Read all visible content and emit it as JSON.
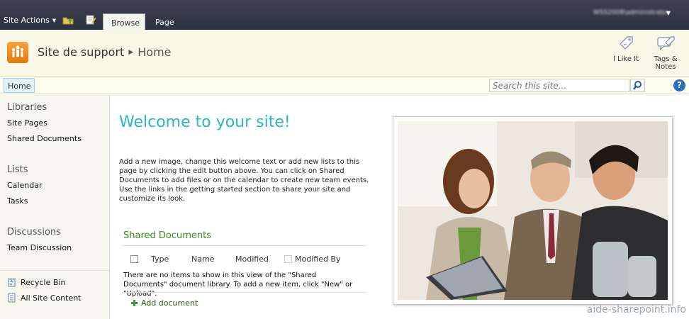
{
  "ribbon": {
    "site_actions": "Site Actions",
    "tabs": [
      "Browse",
      "Page"
    ],
    "user": "WSS2008\\administrator"
  },
  "title_area": {
    "site_name": "Site de support",
    "page_name": "Home",
    "social": [
      {
        "label": "I Like It",
        "icon": "thumbs-up-tag-icon"
      },
      {
        "label": "Tags & Notes",
        "icon": "tags-notes-icon"
      }
    ]
  },
  "top_nav": {
    "home": "Home",
    "search_placeholder": "Search this site..."
  },
  "left_nav": {
    "sections": [
      {
        "heading": "Libraries",
        "items": [
          "Site Pages",
          "Shared Documents"
        ]
      },
      {
        "heading": "Lists",
        "items": [
          "Calendar",
          "Tasks"
        ]
      },
      {
        "heading": "Discussions",
        "items": [
          "Team Discussion"
        ]
      }
    ],
    "bottom": [
      {
        "label": "Recycle Bin",
        "icon": "recycle-bin-icon"
      },
      {
        "label": "All Site Content",
        "icon": "site-content-icon"
      }
    ]
  },
  "main": {
    "welcome_title": "Welcome to your site!",
    "welcome_text": "Add a new image, change this welcome text or add new lists to this page by clicking the edit button above. You can click on Shared Documents to add files or on the calendar to create new team events. Use the links in the getting started section to share your site and customize its look.",
    "web_part": {
      "title": "Shared Documents",
      "columns": [
        "Type",
        "Name",
        "Modified",
        "Modified By"
      ],
      "empty_message": "There are no items to show in this view of the \"Shared Documents\" document library. To add a new item, click \"New\" or \"Upload\".",
      "add_link": "Add document"
    }
  },
  "watermark": "aide-sharepoint.info",
  "colors": {
    "ribbon": "#2d3240",
    "title_area": "#f9f8e8",
    "welcome_title": "#2bb5c9",
    "web_part_title": "#3a8a1a"
  }
}
